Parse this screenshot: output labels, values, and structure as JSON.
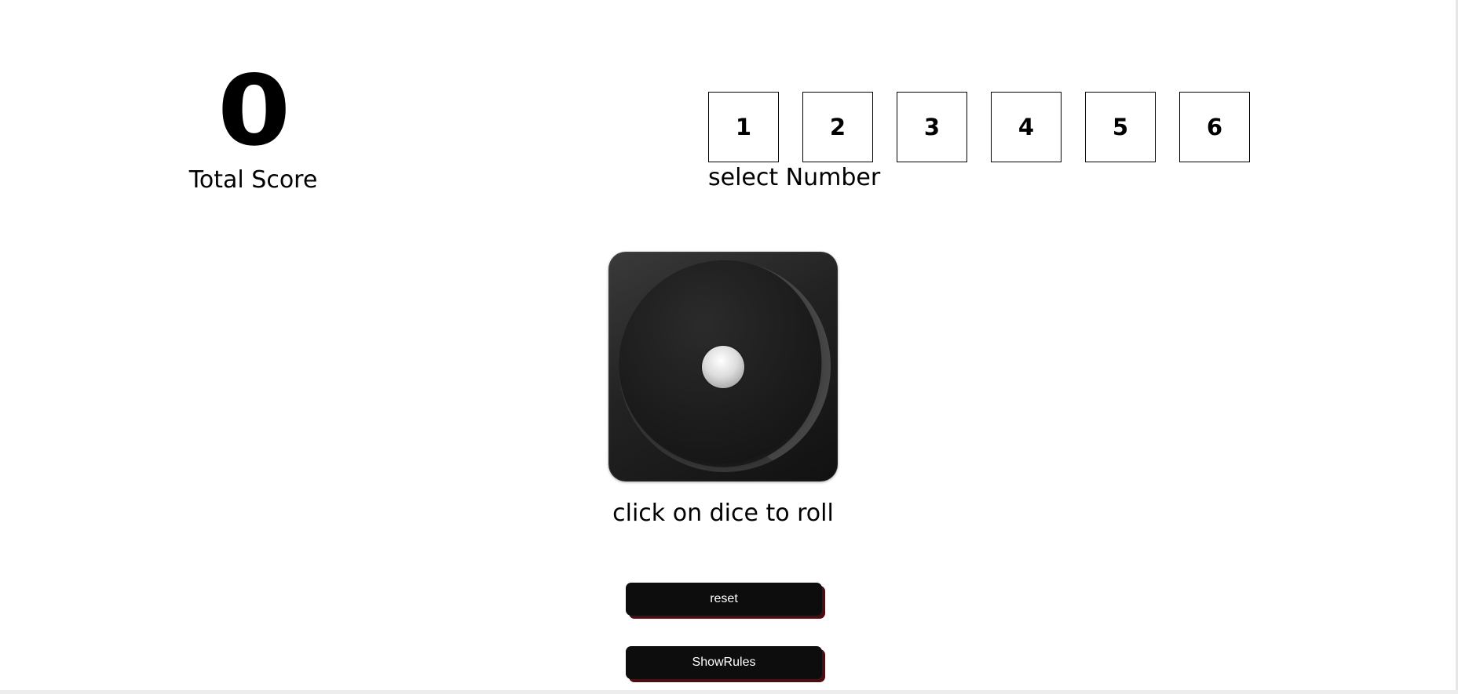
{
  "score": {
    "value": "0",
    "label": "Total Score"
  },
  "selector": {
    "numbers": [
      "1",
      "2",
      "3",
      "4",
      "5",
      "6"
    ],
    "label": "select Number"
  },
  "dice": {
    "face_value": 1,
    "hint": "click on dice to roll"
  },
  "buttons": {
    "reset_label": "reset",
    "rules_label": "ShowRules"
  },
  "colors": {
    "background": "#ffffff",
    "text": "#000000",
    "button_bg": "#0d0d0d",
    "button_shadow": "#4a0d12"
  }
}
